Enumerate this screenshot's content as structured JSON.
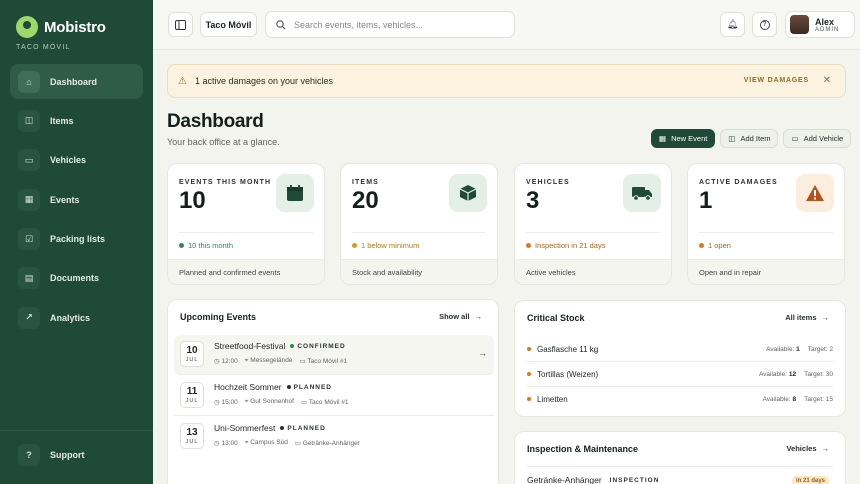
{
  "app": {
    "name": "Mobistro",
    "subtitle": "TACO MÓVIL"
  },
  "sidebar": {
    "items": [
      {
        "label": "Dashboard",
        "icon": "home-icon",
        "active": true
      },
      {
        "label": "Items",
        "icon": "box-icon"
      },
      {
        "label": "Vehicles",
        "icon": "truck-icon"
      },
      {
        "label": "Events",
        "icon": "calendar-icon"
      },
      {
        "label": "Packing lists",
        "icon": "checklist-icon"
      },
      {
        "label": "Documents",
        "icon": "document-icon"
      },
      {
        "label": "Analytics",
        "icon": "chart-icon"
      }
    ],
    "support_label": "Support"
  },
  "topbar": {
    "workspace": "Taco Móvil",
    "search_placeholder": "Search events, items, vehicles...",
    "user": {
      "name": "Alex",
      "role": "ADMIN"
    }
  },
  "alert": {
    "text": "1 active damages on your vehicles",
    "action": "VIEW DAMAGES"
  },
  "header": {
    "title": "Dashboard",
    "subtitle": "Your back office at a glance.",
    "actions": {
      "new_event": "New Event",
      "add_item": "Add Item",
      "add_vehicle": "Add Vehicle"
    }
  },
  "stats": [
    {
      "label": "EVENTS THIS MONTH",
      "value": "10",
      "note": "10 this month",
      "foot": "Planned and confirmed events",
      "color": "#2f8a4e"
    },
    {
      "label": "ITEMS",
      "value": "20",
      "note": "1 below minimum",
      "foot": "Stock and availability",
      "color": "#d99a1a"
    },
    {
      "label": "VEHICLES",
      "value": "3",
      "note": "Inspection in 21 days",
      "foot": "Active vehicles",
      "color": "#d97a1a"
    },
    {
      "label": "ACTIVE DAMAGES",
      "value": "1",
      "note": "1 open",
      "foot": "Open and in repair",
      "color": "#d97a1a"
    }
  ],
  "upcoming": {
    "title": "Upcoming Events",
    "link": "Show all",
    "events": [
      {
        "day": "10",
        "month": "JUL",
        "title": "Streetfood-Festival",
        "status": "CONFIRMED",
        "time": "12:00",
        "place": "Messegelände",
        "vehicle": "Taco Móvil #1"
      },
      {
        "day": "11",
        "month": "JUL",
        "title": "Hochzeit Sommer",
        "status": "PLANNED",
        "time": "15:00",
        "place": "Gut Sonnenhof",
        "vehicle": "Taco Móvil #1"
      },
      {
        "day": "13",
        "month": "JUL",
        "title": "Uni-Sommerfest",
        "status": "PLANNED",
        "time": "13:00",
        "place": "Campus Süd",
        "vehicle": "Getränke-Anhänger"
      }
    ]
  },
  "critical_stock": {
    "title": "Critical Stock",
    "link": "All items",
    "available_label": "Available:",
    "target_label": "Target:",
    "items": [
      {
        "name": "Gasflasche 11 kg",
        "available": "1",
        "target": "2"
      },
      {
        "name": "Tortillas (Weizen)",
        "available": "12",
        "target": "30"
      },
      {
        "name": "Limetten",
        "available": "8",
        "target": "15"
      }
    ]
  },
  "inspection": {
    "title": "Inspection & Maintenance",
    "link": "Vehicles",
    "row": {
      "name": "Getränke-Anhänger",
      "type": "INSPECTION",
      "badge": "in 21 days"
    }
  }
}
